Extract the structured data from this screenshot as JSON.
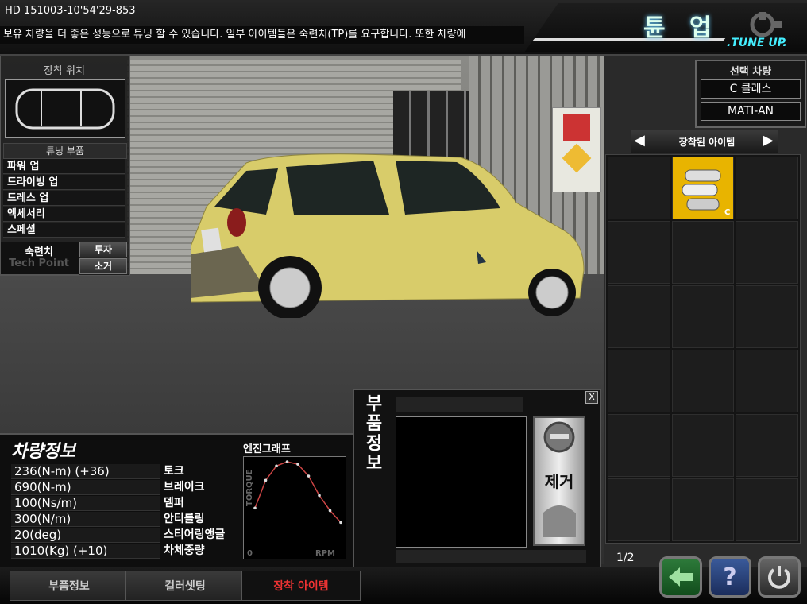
{
  "header": {
    "hd_code": "HD 151003-10'54'29-853",
    "notice": "보유 차량을 더 좋은 성능으로 튜닝 할 수 있습니다. 일부 아이템들은 숙련치(TP)를 요구합니다. 또한 차량에",
    "title_ko": "튠 업",
    "title_en": ".TUNE UP."
  },
  "left_panel": {
    "mount_position_label": "장착 위치",
    "tuning_parts_label": "튜닝 부품",
    "menu": [
      "파워 업",
      "드라이빙 업",
      "드레스 업",
      "액세서리",
      "스페셜"
    ],
    "tech_point_ko": "숙련치",
    "tech_point_en": "Tech Point",
    "invest_label": "투자",
    "remove_small_label": "소거"
  },
  "selected_vehicle": {
    "title": "선택 차량",
    "class": "C 클래스",
    "model": "MATI-AN"
  },
  "installed_items": {
    "title": "장착된 아이템",
    "items": [
      {
        "grade": "C",
        "icon": "engine-manifold-icon"
      }
    ],
    "page": "1/2"
  },
  "vehicle_info": {
    "title": "차량정보",
    "stats": [
      {
        "value": "236(N-m) (+36)",
        "label": "토크"
      },
      {
        "value": "690(N-m)",
        "label": "브레이크"
      },
      {
        "value": "100(Ns/m)",
        "label": "뎀퍼"
      },
      {
        "value": "300(N/m)",
        "label": "안티롤링"
      },
      {
        "value": "20(deg)",
        "label": "스티어링앵글"
      },
      {
        "value": "1010(Kg) (+10)",
        "label": "차체중량"
      }
    ],
    "engine_graph_label": "엔진그래프",
    "graph_y": "TORQUE",
    "graph_x": "RPM",
    "graph_origin": "0"
  },
  "chart_data": {
    "type": "line",
    "title": "엔진그래프",
    "xlabel": "RPM",
    "ylabel": "TORQUE",
    "x": [
      0,
      1,
      2,
      3,
      4,
      5,
      6,
      7,
      8
    ],
    "values": [
      0.45,
      0.78,
      0.95,
      1.0,
      0.97,
      0.83,
      0.6,
      0.42,
      0.28
    ]
  },
  "parts_info": {
    "title": "부품정보",
    "remove_label": "제거",
    "close": "X"
  },
  "tabs": [
    "부품정보",
    "컬러셋팅",
    "장착 아이템"
  ],
  "colors": {
    "accent": "#4ee8ff",
    "item_bg": "#e8b400",
    "active_tab": "#e33333",
    "car": "#d8cc6a"
  }
}
